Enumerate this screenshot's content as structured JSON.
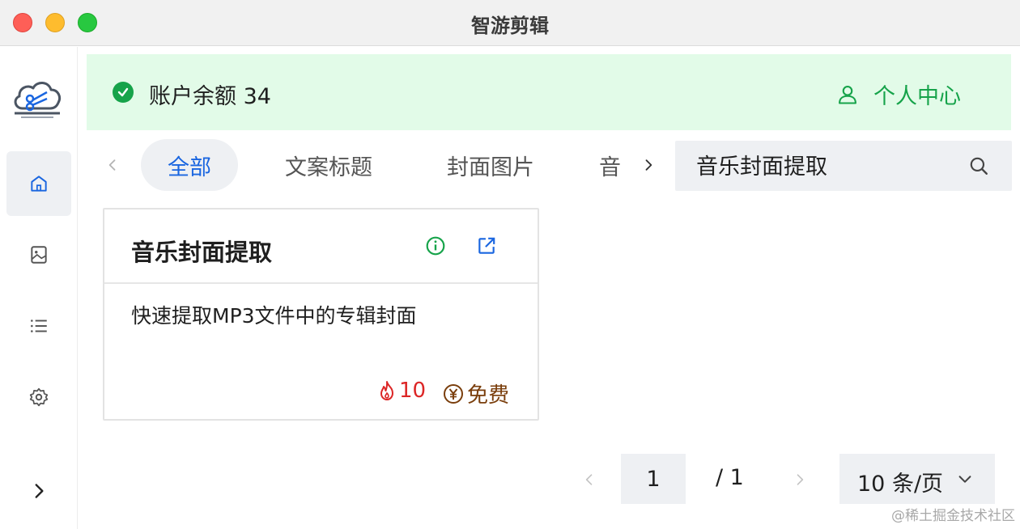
{
  "window": {
    "title": "智游剪辑"
  },
  "banner": {
    "balance_label": "账户余额 34",
    "user_center_label": "个人中心"
  },
  "tabs": [
    {
      "label": "全部",
      "active": true
    },
    {
      "label": "文案标题",
      "active": false
    },
    {
      "label": "封面图片",
      "active": false
    },
    {
      "label": "音",
      "active": false
    }
  ],
  "search": {
    "value": "音乐封面提取"
  },
  "cards": [
    {
      "title": "音乐封面提取",
      "description": "快速提取MP3文件中的专辑封面",
      "hot_count": "10",
      "price_label": "免费"
    }
  ],
  "pagination": {
    "current_page": "1",
    "total_pages": "/  1",
    "page_size_label": "10 条/页"
  },
  "watermark": "@稀土掘金技术社区",
  "colors": {
    "accent_blue": "#1a66e0",
    "success_green": "#16a34a",
    "banner_bg": "#e2fbe8",
    "hot_red": "#dc2626",
    "price_brown": "#7a3e0c"
  },
  "icons": {
    "logo": "cloud-scissors-logo",
    "sidebar": [
      "home-icon",
      "image-icon",
      "list-icon",
      "settings-icon",
      "chevron-right-icon"
    ]
  }
}
